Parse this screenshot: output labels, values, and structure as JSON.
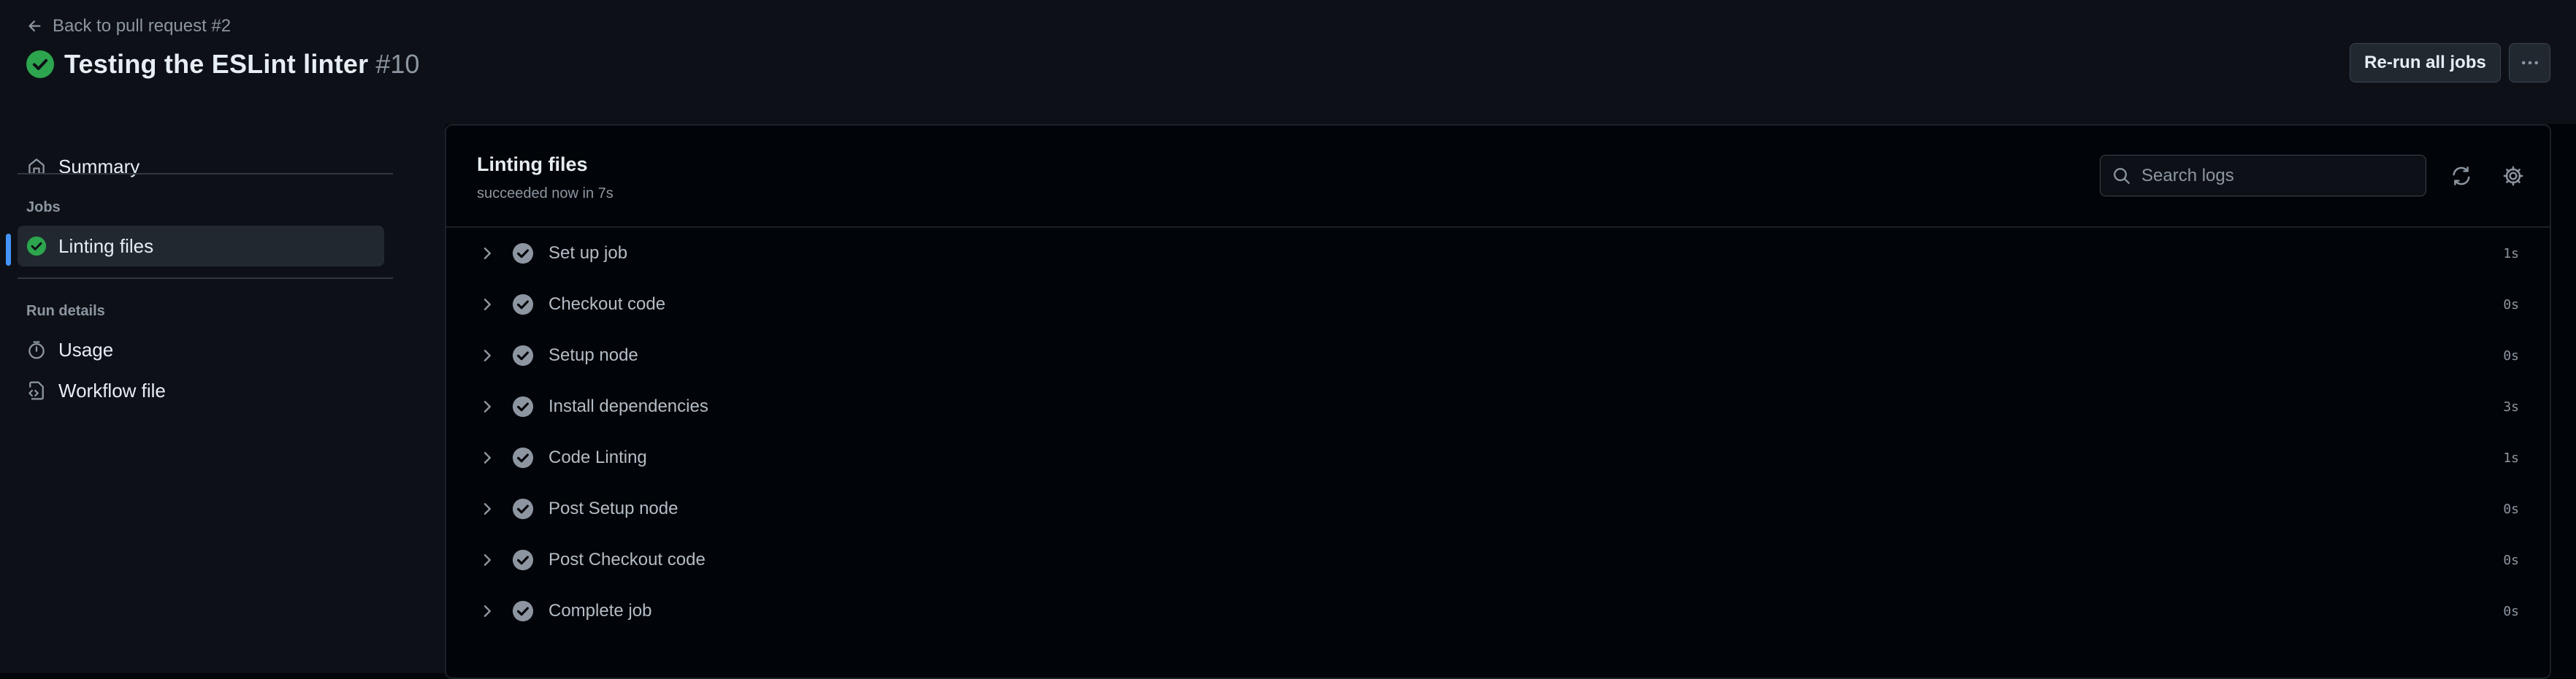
{
  "header": {
    "back_label": "Back to pull request #2",
    "title": "Testing the ESLint linter",
    "run_number": "#10",
    "rerun_label": "Re-run all jobs"
  },
  "sidebar": {
    "summary_label": "Summary",
    "jobs_heading": "Jobs",
    "jobs": [
      {
        "label": "Linting files",
        "status": "success",
        "active": true
      }
    ],
    "run_details_heading": "Run details",
    "usage_label": "Usage",
    "workflow_file_label": "Workflow file"
  },
  "job": {
    "title": "Linting files",
    "subtitle": "succeeded now in 7s",
    "search_placeholder": "Search logs",
    "steps": [
      {
        "name": "Set up job",
        "duration": "1s"
      },
      {
        "name": "Checkout code",
        "duration": "0s"
      },
      {
        "name": "Setup node",
        "duration": "0s"
      },
      {
        "name": "Install dependencies",
        "duration": "3s"
      },
      {
        "name": "Code Linting",
        "duration": "1s"
      },
      {
        "name": "Post Setup node",
        "duration": "0s"
      },
      {
        "name": "Post Checkout code",
        "duration": "0s"
      },
      {
        "name": "Complete job",
        "duration": "0s"
      }
    ]
  },
  "colors": {
    "success": "#2da44e",
    "step_check": "#8d96a0",
    "accent": "#4493f8",
    "page_bg": "#0d1117",
    "panel_bg": "#010409"
  },
  "icons": {
    "back": "arrow-left-icon",
    "status": "check-circle-icon",
    "more": "kebab-horizontal-icon",
    "summary": "home-icon",
    "usage": "stopwatch-icon",
    "workflow_file": "file-code-icon",
    "search": "search-icon",
    "refresh": "sync-icon",
    "settings": "gear-icon",
    "expand": "chevron-right-icon"
  }
}
